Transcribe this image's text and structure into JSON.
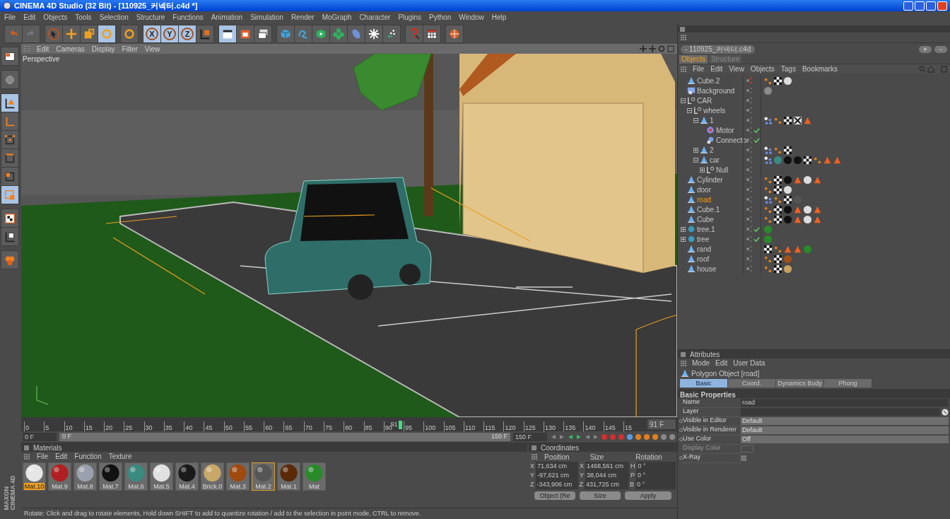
{
  "window": {
    "title": "CINEMA 4D Studio (32 Bit) - [110925_커넥터.c4d *]"
  },
  "menu": [
    "File",
    "Edit",
    "Objects",
    "Tools",
    "Selection",
    "Structure",
    "Functions",
    "Animation",
    "Simulation",
    "Render",
    "MoGraph",
    "Character",
    "Plugins",
    "Python",
    "Window",
    "Help"
  ],
  "toolbar": {
    "groups": [
      [
        {
          "kind": "undo",
          "selected": false
        },
        {
          "kind": "redo",
          "selected": false
        }
      ],
      [
        {
          "kind": "select",
          "selected": false
        },
        {
          "kind": "move",
          "selected": false
        },
        {
          "kind": "scale",
          "selected": false
        },
        {
          "kind": "rotate",
          "selected": true
        }
      ],
      [
        {
          "kind": "rotate",
          "selected": false
        }
      ],
      [
        {
          "kind": "axis",
          "label": "X",
          "selected": true
        },
        {
          "kind": "axis",
          "label": "Y",
          "selected": true
        },
        {
          "kind": "axis",
          "label": "Z",
          "selected": true
        },
        {
          "kind": "coord",
          "selected": false
        }
      ],
      [
        {
          "kind": "clapper",
          "selected": true
        },
        {
          "kind": "render-picture",
          "selected": false
        },
        {
          "kind": "render-settings",
          "selected": false
        }
      ],
      [
        {
          "kind": "cube",
          "selected": false
        },
        {
          "kind": "spline",
          "selected": false
        },
        {
          "kind": "generator",
          "selected": false
        },
        {
          "kind": "cloner",
          "selected": false
        },
        {
          "kind": "deformer",
          "selected": false
        },
        {
          "kind": "sparkle",
          "selected": false
        },
        {
          "kind": "particles",
          "selected": false
        }
      ],
      [
        {
          "kind": "help",
          "selected": false
        },
        {
          "kind": "table",
          "selected": false
        }
      ],
      [
        {
          "kind": "globe",
          "selected": false
        }
      ]
    ]
  },
  "left_tools": {
    "groups": [
      [
        {
          "kind": "layout",
          "selected": false
        }
      ],
      [
        {
          "kind": "sculpt",
          "selected": false
        }
      ],
      [
        {
          "kind": "object-axis",
          "selected": true
        },
        {
          "kind": "axis",
          "selected": false
        },
        {
          "kind": "points",
          "selected": false
        },
        {
          "kind": "edges",
          "selected": false
        },
        {
          "kind": "polygons",
          "selected": false
        },
        {
          "kind": "uv",
          "selected": true
        }
      ],
      [
        {
          "kind": "texture",
          "selected": false
        },
        {
          "kind": "texture-axis",
          "selected": false
        }
      ],
      [
        {
          "kind": "workplane",
          "selected": false
        }
      ]
    ]
  },
  "logo": {
    "line_1": "MAXON",
    "line_2": "CINEMA 4D"
  },
  "viewport": {
    "menu": [
      "Edit",
      "Cameras",
      "Display",
      "Filter",
      "View"
    ],
    "camera": "Perspective"
  },
  "timeline": {
    "ticks": [
      "0",
      "5",
      "10",
      "15",
      "20",
      "25",
      "30",
      "35",
      "40",
      "45",
      "50",
      "55",
      "60",
      "65",
      "70",
      "75",
      "80",
      "85",
      "90",
      "95",
      "100",
      "105",
      "110",
      "115",
      "120",
      "125",
      "130",
      "135",
      "140",
      "145",
      "15"
    ],
    "current_label": "91",
    "level": 0.607,
    "frame": "91 F",
    "start": "0 F",
    "end": "150 F"
  },
  "range_slider": {
    "start_label": "0 F",
    "end_label": "150 F",
    "level": 1
  },
  "materials": {
    "title": "Materials",
    "menu": [
      "File",
      "Edit",
      "Function",
      "Texture"
    ],
    "items": [
      {
        "name": "Mat.10",
        "color": "#e6e6e6",
        "selected": true,
        "framed": false
      },
      {
        "name": "Mat.9",
        "color": "#b02020",
        "selected": false,
        "framed": false
      },
      {
        "name": "Mat.8",
        "color": "#9aa0ac",
        "selected": false,
        "framed": false
      },
      {
        "name": "Mat.7",
        "color": "#111111",
        "selected": false,
        "framed": false
      },
      {
        "name": "Mat.6",
        "color": "#3a8a80",
        "selected": false,
        "framed": false
      },
      {
        "name": "Mat.5",
        "color": "#e0e0e0",
        "selected": false,
        "framed": false
      },
      {
        "name": "Mat.4",
        "color": "#1a1a1a",
        "selected": false,
        "framed": false
      },
      {
        "name": "Brick.0",
        "color": "#c8a868",
        "selected": false,
        "framed": false
      },
      {
        "name": "Mat.3",
        "color": "#a04a10",
        "selected": false,
        "framed": false
      },
      {
        "name": "Mat.2",
        "color": "#555555",
        "selected": false,
        "framed": true
      },
      {
        "name": "Mat.1",
        "color": "#5a2a08",
        "selected": false,
        "framed": false
      },
      {
        "name": "Mat",
        "color": "#2a8a2a",
        "selected": false,
        "framed": false
      }
    ]
  },
  "coordinates": {
    "title": "Coordinates",
    "headers": [
      "Position",
      "Size",
      "Rotation"
    ],
    "rows": [
      {
        "axis": "X",
        "position": "71,634 cm",
        "size_axis": "X",
        "size": "1468,561 cm",
        "rotation_axis": "H",
        "rotation": "0 °"
      },
      {
        "axis": "Y",
        "position": "-97,621 cm",
        "size_axis": "Y",
        "size": "38,044 cm",
        "rotation_axis": "P",
        "rotation": "0 °"
      },
      {
        "axis": "Z",
        "position": "-343,906 cm",
        "size_axis": "Z",
        "size": "431,725 cm",
        "rotation_axis": "B",
        "rotation": "0 °"
      }
    ],
    "mode": "Object (Re",
    "size_mode": "Size",
    "apply": "Apply"
  },
  "status_bar": "Rotate: Click and drag to rotate elements, Hold down SHIFT to add to quantize rotation / add to the selection in point mode, CTRL to remove.",
  "file_tab": "- 110925_커넥터.c4d",
  "file_buttons": [
    "+",
    "-"
  ],
  "objects": {
    "tabs": [
      {
        "label": "Objects",
        "selected": true
      },
      {
        "label": "Structure",
        "selected": false
      }
    ],
    "menu": [
      "File",
      "Edit",
      "View",
      "Objects",
      "Tags",
      "Bookmarks"
    ],
    "items": [
      {
        "name": "Cube.2",
        "kind": "polygon",
        "selected": false,
        "checked": false,
        "hidden": true,
        "tags": [
          {
            "kind": "dots"
          },
          {
            "kind": "checker"
          },
          {
            "kind": "sphere",
            "color": "#dddddd"
          }
        ]
      },
      {
        "name": "Background",
        "kind": "background",
        "selected": false,
        "checked": false,
        "hidden": false,
        "tags": [
          {
            "kind": "sphere",
            "color": "#8a8a8a"
          }
        ]
      },
      {
        "name": "CAR",
        "kind": "null",
        "selected": false,
        "checked": false,
        "hidden": false,
        "expanded": true,
        "children": [
          {
            "name": "wheels",
            "kind": "null",
            "selected": false,
            "checked": false,
            "hidden": false,
            "expanded": true,
            "children": [
              {
                "name": "1",
                "kind": "polygon",
                "selected": false,
                "checked": false,
                "hidden": false,
                "expanded": true,
                "tags": [
                  {
                    "kind": "cluster"
                  },
                  {
                    "kind": "dots"
                  },
                  {
                    "kind": "checker"
                  },
                  {
                    "kind": "crossed"
                  },
                  {
                    "kind": "triangle"
                  }
                ],
                "children": [
                  {
                    "name": "Motor",
                    "kind": "motor",
                    "selected": false,
                    "checked": true,
                    "hidden": false
                  },
                  {
                    "name": "Connector",
                    "kind": "connector",
                    "selected": false,
                    "checked": true,
                    "hidden": false
                  }
                ]
              },
              {
                "name": "2",
                "kind": "polygon",
                "selected": false,
                "checked": false,
                "hidden": false,
                "expanded": false,
                "tags": [
                  {
                    "kind": "cluster"
                  },
                  {
                    "kind": "dots"
                  },
                  {
                    "kind": "checker"
                  }
                ]
              },
              {
                "name": "car",
                "kind": "polygon",
                "selected": false,
                "checked": false,
                "hidden": false,
                "expanded": true,
                "tags": [
                  {
                    "kind": "cluster"
                  },
                  {
                    "kind": "sphere",
                    "color": "#3a8a80"
                  },
                  {
                    "kind": "sphere",
                    "color": "#111111"
                  },
                  {
                    "kind": "sphere",
                    "color": "#111111"
                  },
                  {
                    "kind": "checker"
                  },
                  {
                    "kind": "dots"
                  },
                  {
                    "kind": "triangle"
                  },
                  {
                    "kind": "triangle"
                  }
                ],
                "children": [
                  {
                    "name": "Null",
                    "kind": "null",
                    "selected": false,
                    "checked": false,
                    "hidden": false,
                    "expanded": false
                  }
                ]
              }
            ]
          }
        ]
      },
      {
        "name": "Cylinder",
        "kind": "polygon",
        "selected": false,
        "checked": false,
        "hidden": false,
        "tags": [
          {
            "kind": "dots"
          },
          {
            "kind": "checker"
          },
          {
            "kind": "sphere",
            "color": "#111111"
          },
          {
            "kind": "triangle"
          },
          {
            "kind": "sphere",
            "color": "#dddddd"
          },
          {
            "kind": "triangle"
          }
        ]
      },
      {
        "name": "door",
        "kind": "polygon",
        "selected": false,
        "checked": false,
        "hidden": false,
        "tags": [
          {
            "kind": "dots"
          },
          {
            "kind": "checker"
          },
          {
            "kind": "sphere",
            "color": "#dddddd"
          }
        ]
      },
      {
        "name": "road",
        "kind": "polygon",
        "selected": true,
        "checked": false,
        "hidden": false,
        "tags": [
          {
            "kind": "cluster"
          },
          {
            "kind": "dots"
          },
          {
            "kind": "checker"
          },
          {
            "kind": "sphere",
            "color": "#555555"
          }
        ]
      },
      {
        "name": "Cube.1",
        "kind": "polygon",
        "selected": false,
        "checked": false,
        "hidden": false,
        "tags": [
          {
            "kind": "dots"
          },
          {
            "kind": "checker"
          },
          {
            "kind": "sphere",
            "color": "#111111"
          },
          {
            "kind": "triangle"
          },
          {
            "kind": "sphere",
            "color": "#dddddd"
          },
          {
            "kind": "triangle"
          }
        ]
      },
      {
        "name": "Cube",
        "kind": "polygon",
        "selected": false,
        "checked": false,
        "hidden": false,
        "tags": [
          {
            "kind": "dots"
          },
          {
            "kind": "checker"
          },
          {
            "kind": "sphere",
            "color": "#111111"
          },
          {
            "kind": "triangle"
          },
          {
            "kind": "sphere",
            "color": "#dddddd"
          },
          {
            "kind": "triangle"
          }
        ]
      },
      {
        "name": "tree.1",
        "kind": "tree",
        "selected": false,
        "checked": true,
        "hidden": false,
        "expanded": false,
        "tags": [
          {
            "kind": "sphere",
            "color": "#2a8a2a"
          }
        ]
      },
      {
        "name": "tree",
        "kind": "tree",
        "selected": false,
        "checked": true,
        "hidden": false,
        "expanded": false,
        "tags": [
          {
            "kind": "sphere",
            "color": "#2a8a2a"
          }
        ]
      },
      {
        "name": "rand",
        "kind": "polygon",
        "selected": false,
        "checked": false,
        "hidden": false,
        "tags": [
          {
            "kind": "checker"
          },
          {
            "kind": "dots"
          },
          {
            "kind": "triangle"
          },
          {
            "kind": "triangle"
          },
          {
            "kind": "sphere",
            "color": "#2a8a2a"
          }
        ]
      },
      {
        "name": "roof",
        "kind": "polygon",
        "selected": false,
        "checked": false,
        "hidden": false,
        "tags": [
          {
            "kind": "dots"
          },
          {
            "kind": "checker"
          },
          {
            "kind": "sphere",
            "color": "#a0501a"
          }
        ]
      },
      {
        "name": "house",
        "kind": "polygon",
        "selected": false,
        "checked": false,
        "hidden": false,
        "tags": [
          {
            "kind": "dots"
          },
          {
            "kind": "checker"
          },
          {
            "kind": "sphere",
            "color": "#c8a060"
          }
        ]
      }
    ]
  },
  "attributes": {
    "title": "Attributes",
    "menu": [
      "Mode",
      "Edit",
      "User Data"
    ],
    "object": "Polygon Object [road]",
    "tabs": [
      {
        "label": "Basic",
        "selected": true
      },
      {
        "label": "Coord.",
        "selected": false
      },
      {
        "label": "Dynamics Body",
        "selected": false
      },
      {
        "label": "Phong",
        "selected": false
      }
    ],
    "section": "Basic Properties",
    "properties": [
      {
        "label": "Name",
        "kind": "text",
        "value": "road",
        "disabled": false,
        "keyframe_dot": false
      },
      {
        "label": "Layer",
        "kind": "layer",
        "disabled": false,
        "keyframe_dot": false
      },
      {
        "label": "Visible in Editor",
        "kind": "dropdown",
        "value": "Default",
        "disabled": false,
        "keyframe_dot": true
      },
      {
        "label": "Visible in Renderer",
        "kind": "dropdown",
        "value": "Default",
        "disabled": false,
        "keyframe_dot": true
      },
      {
        "label": "Use Color",
        "kind": "dropdown",
        "value": "Off",
        "disabled": false,
        "keyframe_dot": true
      },
      {
        "label": "Display Color",
        "kind": "color",
        "disabled": true,
        "keyframe_dot": false
      },
      {
        "label": "X-Ray",
        "kind": "checkbox",
        "checked": false,
        "disabled": false,
        "keyframe_dot": true
      }
    ]
  }
}
